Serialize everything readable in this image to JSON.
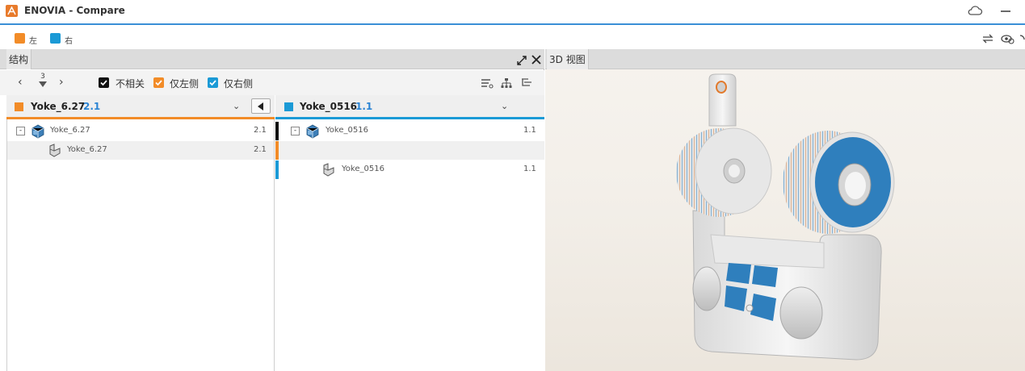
{
  "window": {
    "title": "ENOVIA - Compare",
    "icons": [
      "cloud-icon",
      "minimize-icon"
    ]
  },
  "legend": {
    "left_label": "左",
    "right_label": "右",
    "left_color": "#f28c28",
    "right_color": "#1b9ad6"
  },
  "structure_panel": {
    "tab": "结构",
    "navigation": {
      "level": "3"
    },
    "filters": [
      {
        "label": "不相关",
        "checked": true,
        "color": "#111111"
      },
      {
        "label": "仅左侧",
        "checked": true,
        "color": "#f28c28"
      },
      {
        "label": "仅右侧",
        "checked": true,
        "color": "#1b9ad6"
      }
    ],
    "left_column": {
      "name": "Yoke_6.27",
      "revision": "2.1",
      "rows": [
        {
          "name": "Yoke_6.27",
          "revision": "2.1",
          "type": "assembly",
          "expanded": true
        },
        {
          "name": "Yoke_6.27",
          "revision": "2.1",
          "type": "part"
        }
      ]
    },
    "right_column": {
      "name": "Yoke_0516",
      "revision": "1.1",
      "rows": [
        {
          "name": "Yoke_0516",
          "revision": "1.1",
          "type": "assembly",
          "expanded": true,
          "marker": "#111111"
        },
        {
          "name": "",
          "revision": "",
          "type": "empty",
          "marker": "#f28c28"
        },
        {
          "name": "Yoke_0516",
          "revision": "1.1",
          "type": "part",
          "marker": "#1b9ad6"
        }
      ]
    }
  },
  "view3d": {
    "tab": "3D 视图"
  }
}
